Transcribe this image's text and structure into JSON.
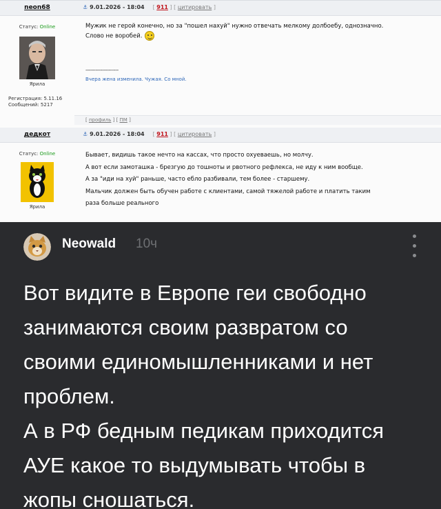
{
  "posts": [
    {
      "username": "neon68",
      "date": "9.01.2026 - 18:04",
      "post_number": "911",
      "quote_label": "цитировать",
      "status_label": "Статус:",
      "status_value": "Online",
      "avatar_caption": "Ярила",
      "registration": "Регистрация: 5.11.16",
      "messages": "Сообщений: 5217",
      "lines": [
        "Мужик не герой конечно, но за \"пошел нахуй\" нужно отвечать мелкому долбоебу, однозначно.",
        "Слово не воробей."
      ],
      "signature_rule": "--------------------",
      "signature": "Вчера жена изменила. Чужая. Со мной.",
      "footer_profile": "профиль",
      "footer_pm": "ПМ"
    },
    {
      "username": "дедкот",
      "date": "9.01.2026 - 18:04",
      "post_number": "911",
      "quote_label": "цитировать",
      "status_label": "Статус:",
      "status_value": "Online",
      "avatar_caption": "Ярила",
      "lines": [
        "Бывает, видишь такое нечто на кассах, что просто охуеваешь, но молчу.",
        "А вот если замоташка - брезгую до тошноты и рвотного рефлекса, не иду к ним вообще.",
        "А за \"иди на хуй\" раньше, часто ебло разбивали, тем более - старшему.",
        "Мальчик должен быть обучен работе с клиентами, самой тяжелой работе и платить таким",
        "раза больше реального"
      ]
    }
  ],
  "comment": {
    "author": "Neowald",
    "time": "10ч",
    "lines": [
      "Вот видите в Европе геи свободно",
      "занимаются своим развратом со",
      "своими единомышленниками и нет",
      "проблем.",
      "А в РФ бедным педикам приходится",
      "АУЕ какое то выдумывать чтобы в",
      "жопы сношаться."
    ]
  },
  "colors": {
    "comment_bg": "#2a2b2e",
    "online": "#1a9a1a",
    "post_number": "#c0121a",
    "link": "#2d66b8"
  },
  "icons": [
    "anchor-icon",
    "smiley-icon",
    "more-vertical-icon"
  ]
}
